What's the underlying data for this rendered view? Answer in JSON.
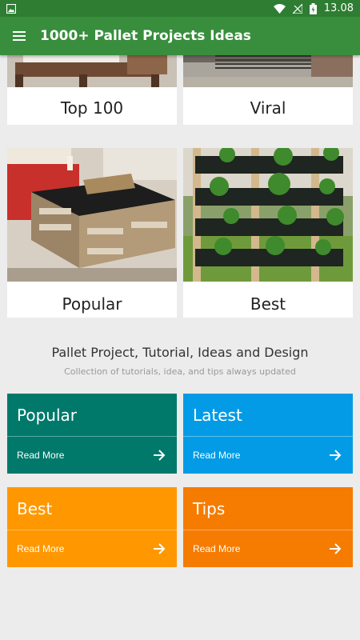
{
  "status_bar": {
    "time": "13.08"
  },
  "app_bar": {
    "title": "1000+ Pallet Projects Ideas",
    "menu_icon": "hamburger-menu-icon"
  },
  "tiles": [
    {
      "label": "Top 100"
    },
    {
      "label": "Viral"
    },
    {
      "label": "Popular"
    },
    {
      "label": "Best"
    }
  ],
  "section": {
    "title": "Pallet Project, Tutorial, Ideas and Design",
    "subtitle": "Collection of tutorials, idea, and tips always updated"
  },
  "cards": [
    {
      "title": "Popular",
      "read_more": "Read More",
      "color": "#00796b",
      "icon": "arrow-right-icon"
    },
    {
      "title": "Latest",
      "read_more": "Read More",
      "color": "#039be5",
      "icon": "arrow-right-icon"
    },
    {
      "title": "Best",
      "read_more": "Read More",
      "color": "#ff9800",
      "icon": "arrow-right-icon"
    },
    {
      "title": "Tips",
      "read_more": "Read More",
      "color": "#f57c00",
      "icon": "arrow-right-icon"
    }
  ],
  "colors": {
    "status_bar": "#2e7d32",
    "app_bar": "#388e3c",
    "background": "#ececec"
  }
}
